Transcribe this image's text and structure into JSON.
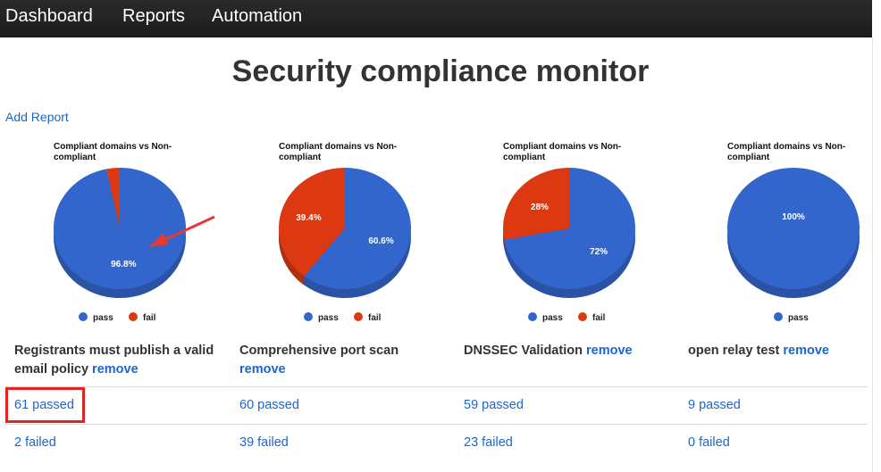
{
  "nav": {
    "items": [
      "Dashboard",
      "Reports",
      "Automation"
    ]
  },
  "page": {
    "title": "Security compliance monitor",
    "add_report": "Add Report"
  },
  "colors": {
    "pass": "#3366cc",
    "fail": "#dc3912",
    "link": "#1a66d1",
    "highlight": "#e02424"
  },
  "chart_data": [
    {
      "type": "pie",
      "title": "Compliant domains vs Non-compliant",
      "labels": [
        "pass",
        "fail"
      ],
      "values": [
        96.8,
        3.2
      ],
      "slice_labels": [
        "96.8%",
        ""
      ],
      "legend": [
        "pass",
        "fail"
      ]
    },
    {
      "type": "pie",
      "title": "Compliant domains vs Non-compliant",
      "labels": [
        "pass",
        "fail"
      ],
      "values": [
        60.6,
        39.4
      ],
      "slice_labels": [
        "60.6%",
        "39.4%"
      ],
      "legend": [
        "pass",
        "fail"
      ]
    },
    {
      "type": "pie",
      "title": "Compliant domains vs Non-compliant",
      "labels": [
        "pass",
        "fail"
      ],
      "values": [
        72,
        28
      ],
      "slice_labels": [
        "72%",
        "28%"
      ],
      "legend": [
        "pass",
        "fail"
      ]
    },
    {
      "type": "pie",
      "title": "Compliant domains vs Non-compliant",
      "labels": [
        "pass"
      ],
      "values": [
        100
      ],
      "slice_labels": [
        "100%"
      ],
      "legend": [
        "pass"
      ]
    }
  ],
  "reports": [
    {
      "title": "Registrants must publish a valid email policy",
      "remove": "remove",
      "passed": "61 passed",
      "failed": "2 failed"
    },
    {
      "title": "Comprehensive port scan",
      "remove": "remove",
      "passed": "60 passed",
      "failed": "39 failed"
    },
    {
      "title": "DNSSEC Validation",
      "remove": "remove",
      "passed": "59 passed",
      "failed": "23 failed"
    },
    {
      "title": "open relay test",
      "remove": "remove",
      "passed": "9 passed",
      "failed": "0 failed"
    }
  ]
}
